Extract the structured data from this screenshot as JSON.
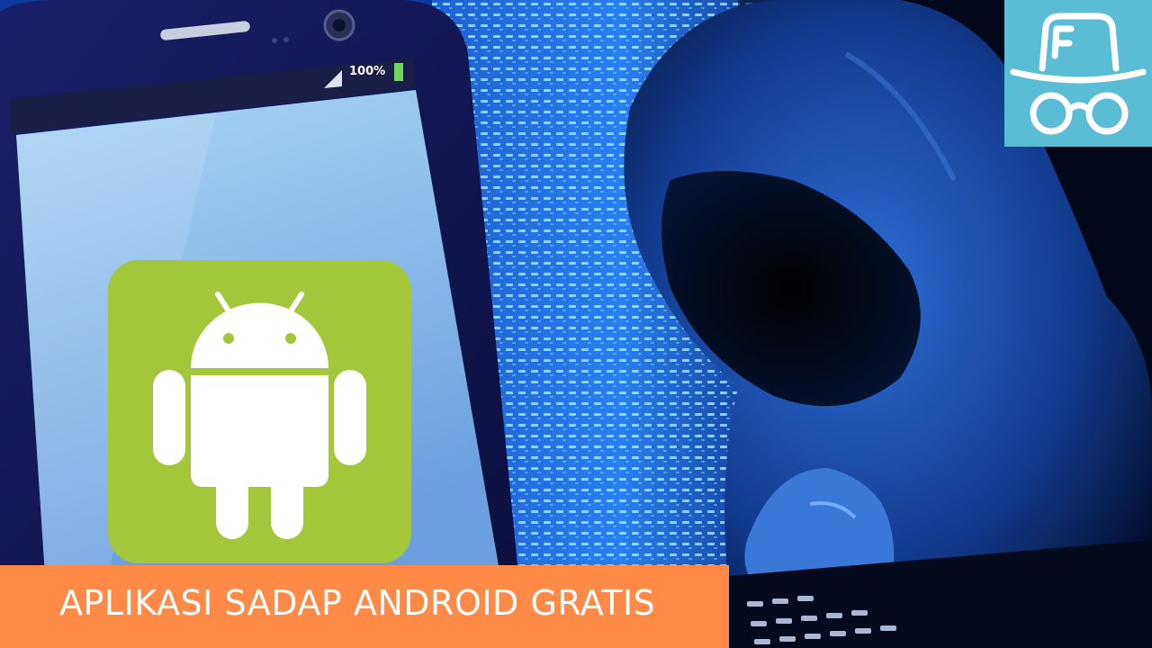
{
  "banner": {
    "title": "APLIKASI SADAP ANDROID GRATIS"
  },
  "phone": {
    "battery_text": "100%"
  },
  "colors": {
    "banner_orange": "#ff8a47",
    "android_green": "#a4c63a",
    "badge_blue": "#5bbcd6",
    "phone_screen": "#8fc0e8",
    "background_dark": "#02071a"
  },
  "icons": [
    "android-robot-icon",
    "incognito-hat-glasses-icon",
    "signal-strength-icon",
    "front-camera-icon"
  ]
}
